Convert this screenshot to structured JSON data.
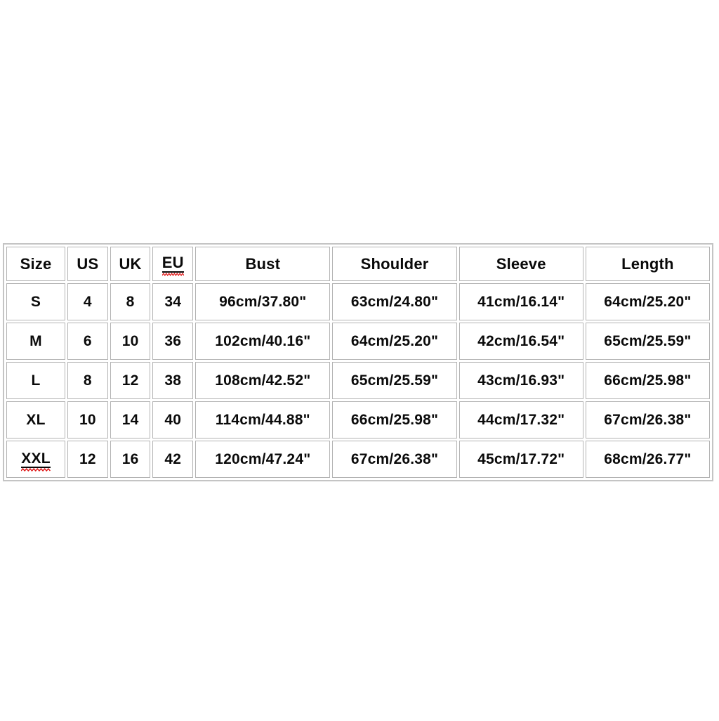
{
  "table": {
    "columns": [
      {
        "key": "size",
        "label": "Size",
        "spellcheck_flag": false
      },
      {
        "key": "us",
        "label": "US",
        "spellcheck_flag": false
      },
      {
        "key": "uk",
        "label": "UK",
        "spellcheck_flag": false
      },
      {
        "key": "eu",
        "label": "EU",
        "spellcheck_flag": true
      },
      {
        "key": "bust",
        "label": "Bust",
        "spellcheck_flag": false
      },
      {
        "key": "shoulder",
        "label": "Shoulder",
        "spellcheck_flag": false
      },
      {
        "key": "sleeve",
        "label": "Sleeve",
        "spellcheck_flag": false
      },
      {
        "key": "length",
        "label": "Length",
        "spellcheck_flag": false
      }
    ],
    "rows": [
      {
        "size": "S",
        "size_spellcheck_flag": false,
        "us": "4",
        "uk": "8",
        "eu": "34",
        "bust": "96cm/37.80\"",
        "shoulder": "63cm/24.80\"",
        "sleeve": "41cm/16.14\"",
        "length": "64cm/25.20\""
      },
      {
        "size": "M",
        "size_spellcheck_flag": false,
        "us": "6",
        "uk": "10",
        "eu": "36",
        "bust": "102cm/40.16\"",
        "shoulder": "64cm/25.20\"",
        "sleeve": "42cm/16.54\"",
        "length": "65cm/25.59\""
      },
      {
        "size": "L",
        "size_spellcheck_flag": false,
        "us": "8",
        "uk": "12",
        "eu": "38",
        "bust": "108cm/42.52\"",
        "shoulder": "65cm/25.59\"",
        "sleeve": "43cm/16.93\"",
        "length": "66cm/25.98\""
      },
      {
        "size": "XL",
        "size_spellcheck_flag": false,
        "us": "10",
        "uk": "14",
        "eu": "40",
        "bust": "114cm/44.88\"",
        "shoulder": "66cm/25.98\"",
        "sleeve": "44cm/17.32\"",
        "length": "67cm/26.38\""
      },
      {
        "size": "XXL",
        "size_spellcheck_flag": true,
        "us": "12",
        "uk": "16",
        "eu": "42",
        "bust": "120cm/47.24\"",
        "shoulder": "67cm/26.38\"",
        "sleeve": "45cm/17.72\"",
        "length": "68cm/26.77\""
      }
    ]
  },
  "colors": {
    "page_background": "#ffffff",
    "cell_background": "#ffffff",
    "cell_border": "#b3b3b3",
    "table_border": "#c4c4c4",
    "text": "#0a0a0a",
    "spellcheck_squiggle": "#e01b1b"
  }
}
